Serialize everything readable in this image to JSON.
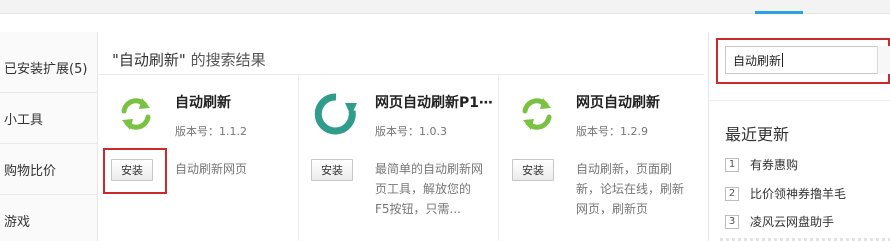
{
  "sidebar": {
    "items": [
      {
        "label": "已安装扩展(5)"
      },
      {
        "label": "小工具"
      },
      {
        "label": "购物比价"
      },
      {
        "label": "游戏"
      }
    ]
  },
  "main": {
    "results_query": "\"自动刷新\"",
    "results_suffix": " 的搜索结果",
    "cards": [
      {
        "name": "自动刷新",
        "version": "版本号：1.1.2",
        "description": "自动刷新网页",
        "install_label": "安装",
        "icon": "green-refresh-icon"
      },
      {
        "name": "网页自动刷新P1⋯",
        "version": "版本号：1.0.3",
        "description": "最简单的自动刷新网页工具，解放您的F5按钮，只需...",
        "install_label": "安装",
        "icon": "teal-circular-arrow-icon"
      },
      {
        "name": "网页自动刷新",
        "version": "版本号：1.2.9",
        "description": "自动刷新，页面刷新，论坛在线，刷新网页，刷新页",
        "install_label": "安装",
        "icon": "green-refresh-icon"
      }
    ]
  },
  "right_panel": {
    "search": {
      "value": "自动刷新"
    },
    "recent_title": "最近更新",
    "recent_items": [
      {
        "index": "1",
        "label": "有券惠购"
      },
      {
        "index": "2",
        "label": "比价领神券撸羊毛"
      },
      {
        "index": "3",
        "label": "凌风云网盘助手"
      }
    ]
  },
  "colors": {
    "highlight_border": "#cc2a2a",
    "refresh_green": "#7cc242",
    "refresh_teal": "#2f9c8c",
    "tab_accent": "#2ea1e0"
  }
}
